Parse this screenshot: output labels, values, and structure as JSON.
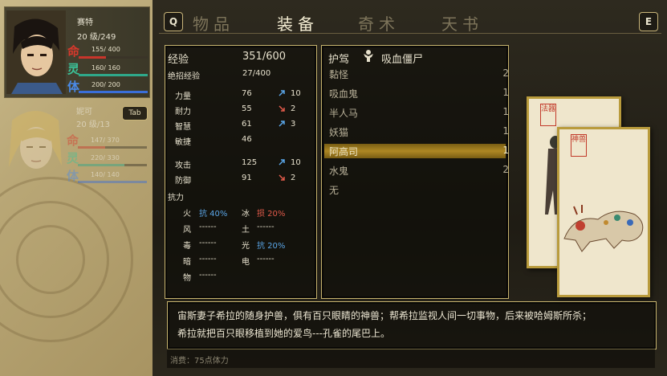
{
  "tabs": {
    "left_key": "Q",
    "right_key": "E",
    "items": [
      "物品",
      "装备",
      "奇术",
      "天书"
    ],
    "active_index": 1
  },
  "characters": [
    {
      "name": "赛特",
      "level": "20 级/249",
      "kanji": [
        "命",
        "灵",
        "体"
      ],
      "stats": [
        "155/ 400",
        "160/ 160",
        "200/ 200"
      ],
      "fill": [
        0.39,
        1.0,
        1.0
      ],
      "colors": [
        "#c8352b",
        "#2fa88a",
        "#3a6ed8"
      ]
    },
    {
      "name": "妮可",
      "level": "20 级/13",
      "kanji": [
        "命",
        "灵",
        "体"
      ],
      "stats": [
        "147/ 370",
        "220/ 330",
        "140/ 140"
      ],
      "fill": [
        0.4,
        0.67,
        1.0
      ],
      "colors": [
        "#c8352b",
        "#2fa88a",
        "#3a6ed8"
      ]
    }
  ],
  "tab_key": "Tab",
  "stats_panel": {
    "exp_label": "经验",
    "exp_value": "351/600",
    "skill_exp_label": "绝招经验",
    "skill_exp_value": "27/400",
    "attrs": [
      {
        "label": "力量",
        "value": "76",
        "mod": "10",
        "dir": "up"
      },
      {
        "label": "耐力",
        "value": "55",
        "mod": "2",
        "dir": "down"
      },
      {
        "label": "智慧",
        "value": "61",
        "mod": "3",
        "dir": "up"
      },
      {
        "label": "敏捷",
        "value": "46",
        "mod": "",
        "dir": ""
      }
    ],
    "combat": [
      {
        "label": "攻击",
        "value": "125",
        "mod": "10",
        "dir": "up"
      },
      {
        "label": "防御",
        "value": "91",
        "mod": "2",
        "dir": "down"
      }
    ],
    "resist_label": "抗力",
    "resist": [
      {
        "el": "火",
        "val": "抗 40%",
        "tone": "blue"
      },
      {
        "el": "冰",
        "val": "损 20%",
        "tone": "red"
      },
      {
        "el": "风",
        "val": "------",
        "tone": "plain"
      },
      {
        "el": "土",
        "val": "------",
        "tone": "plain"
      },
      {
        "el": "毒",
        "val": "------",
        "tone": "plain"
      },
      {
        "el": "光",
        "val": "抗 20%",
        "tone": "blue"
      },
      {
        "el": "暗",
        "val": "------",
        "tone": "plain"
      },
      {
        "el": "电",
        "val": "------",
        "tone": "plain"
      },
      {
        "el": "物",
        "val": "------",
        "tone": "plain"
      }
    ]
  },
  "guard_panel": {
    "header_label": "护驾",
    "header_icon": "vampire-zombie-icon",
    "equipped": "吸血僵尸",
    "items": [
      {
        "name": "黏怪",
        "count": "2"
      },
      {
        "name": "吸血鬼",
        "count": "1"
      },
      {
        "name": "半人马",
        "count": "1"
      },
      {
        "name": "妖猫",
        "count": "1"
      },
      {
        "name": "阿高司",
        "count": "1"
      },
      {
        "name": "水鬼",
        "count": "2"
      },
      {
        "name": "无",
        "count": ""
      }
    ],
    "selected_index": 4
  },
  "cards": {
    "back_seal": "法器",
    "front_seal": "神兽"
  },
  "description": {
    "line1": "宙斯妻子希拉的随身护兽，俱有百只眼睛的神兽；帮希拉监视人间一切事物，后来被哈姆斯所杀；",
    "line2": "希拉就把百只眼移植到她的爱鸟---孔雀的尾巴上。"
  },
  "cost": "消费：75点体力"
}
